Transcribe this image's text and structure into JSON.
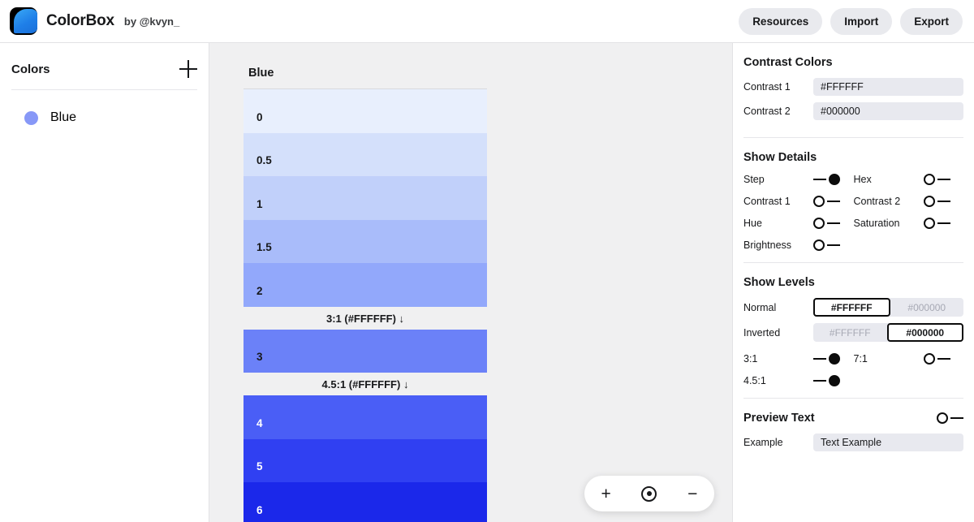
{
  "header": {
    "logo_icon": "colorbox-logo-icon",
    "brand_name": "ColorBox",
    "brand_by": "by @kvyn_",
    "buttons": [
      {
        "label": "Resources"
      },
      {
        "label": "Import"
      },
      {
        "label": "Export"
      }
    ]
  },
  "sidebar": {
    "title": "Colors",
    "add_icon": "plus-icon",
    "items": [
      {
        "label": "Blue",
        "swatch": "#8798f7"
      }
    ]
  },
  "main": {
    "scale_title": "Blue",
    "zoom_controls": {
      "zoom_in": "+",
      "reset_icon": "target-icon",
      "zoom_out": "−"
    },
    "rows": [
      {
        "kind": "swatch",
        "label": "0",
        "color": "#e8effd",
        "text_color": "#17181a"
      },
      {
        "kind": "swatch",
        "label": "0.5",
        "color": "#d4e0fb",
        "text_color": "#17181a"
      },
      {
        "kind": "swatch",
        "label": "1",
        "color": "#c1d0fa",
        "text_color": "#17181a"
      },
      {
        "kind": "swatch",
        "label": "1.5",
        "color": "#a9bcfa",
        "text_color": "#17181a"
      },
      {
        "kind": "swatch",
        "label": "2",
        "color": "#92a8fb",
        "text_color": "#17181a"
      },
      {
        "kind": "ratio",
        "label": "3:1 (#FFFFFF)",
        "arrow": "↓"
      },
      {
        "kind": "swatch",
        "label": "3",
        "color": "#6b81f8",
        "text_color": "#17181a"
      },
      {
        "kind": "ratio",
        "label": "4.5:1 (#FFFFFF)",
        "arrow": "↓"
      },
      {
        "kind": "swatch",
        "label": "4",
        "color": "#4a5ef6",
        "text_color": "#ffffff"
      },
      {
        "kind": "swatch",
        "label": "5",
        "color": "#3040f2",
        "text_color": "#ffffff"
      },
      {
        "kind": "swatch",
        "label": "6",
        "color": "#1b28ea",
        "text_color": "#ffffff"
      }
    ]
  },
  "right_panel": {
    "contrast_colors": {
      "title": "Contrast Colors",
      "fields": [
        {
          "label": "Contrast 1",
          "value": "#FFFFFF"
        },
        {
          "label": "Contrast 2",
          "value": "#000000"
        }
      ]
    },
    "show_details": {
      "title": "Show Details",
      "toggles": [
        {
          "label": "Step",
          "on": true
        },
        {
          "label": "Hex",
          "on": false
        },
        {
          "label": "Contrast 1",
          "on": false
        },
        {
          "label": "Contrast 2",
          "on": false
        },
        {
          "label": "Hue",
          "on": false
        },
        {
          "label": "Saturation",
          "on": false
        },
        {
          "label": "Brightness",
          "on": false
        }
      ]
    },
    "show_levels": {
      "title": "Show Levels",
      "segments": [
        {
          "label": "Normal",
          "options": [
            "#FFFFFF",
            "#000000"
          ],
          "selected": 0
        },
        {
          "label": "Inverted",
          "options": [
            "#FFFFFF",
            "#000000"
          ],
          "selected": 1
        }
      ],
      "toggles": [
        {
          "label": "3:1",
          "on": true
        },
        {
          "label": "7:1",
          "on": false
        },
        {
          "label": "4.5:1",
          "on": true
        }
      ]
    },
    "preview_text": {
      "title": "Preview Text",
      "enabled": false,
      "field": {
        "label": "Example",
        "value": "Text Example"
      }
    }
  }
}
